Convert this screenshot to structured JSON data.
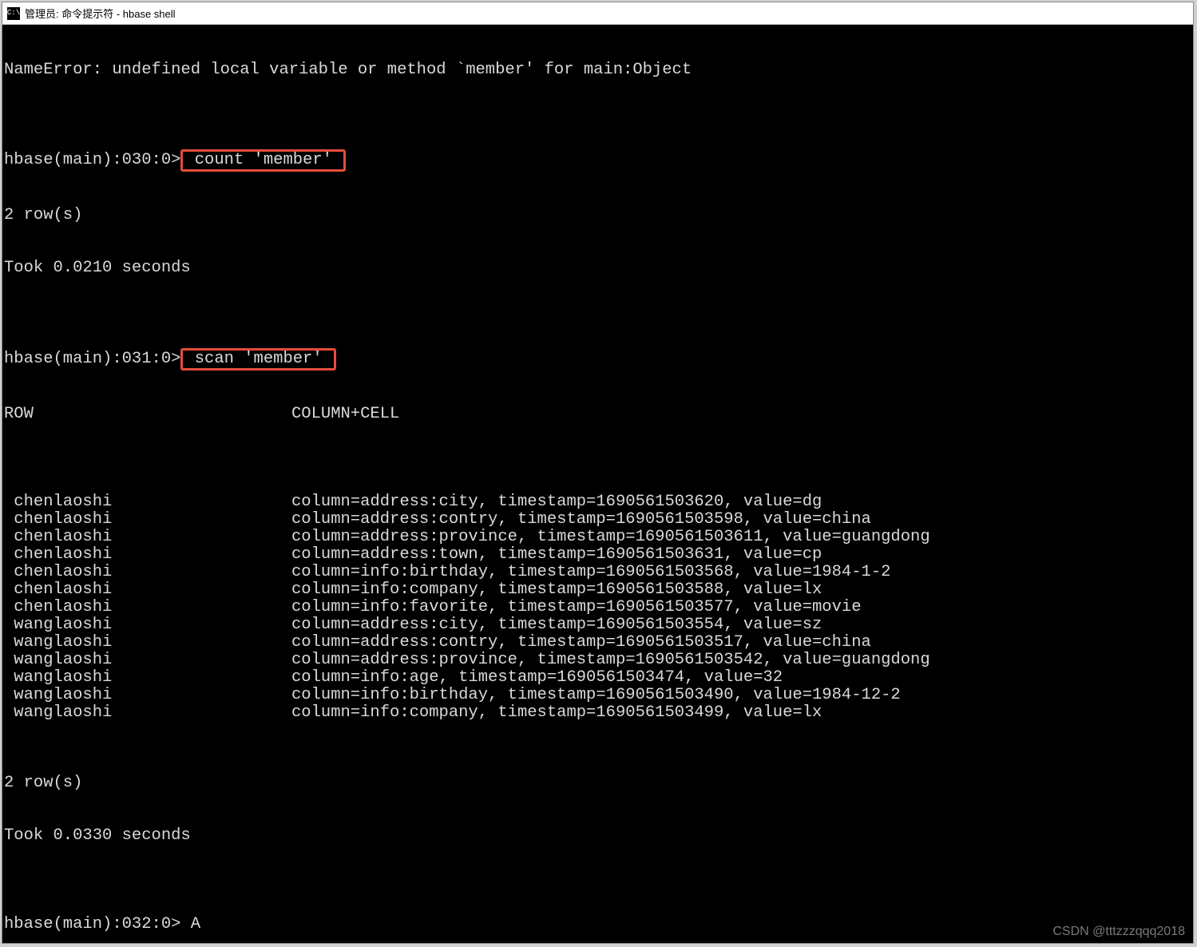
{
  "window": {
    "title": "管理员: 命令提示符 - hbase  shell",
    "icon_label": "C:\\"
  },
  "terminal": {
    "error_line": "NameError: undefined local variable or method `member' for main:Object",
    "prompt1_prefix": "hbase(main):030:0>",
    "prompt1_cmd": " count 'member' ",
    "result1_rows": "2 row(s)",
    "result1_time": "Took 0.0210 seconds",
    "prompt2_prefix": "hbase(main):031:0>",
    "prompt2_cmd": " scan 'member' ",
    "header_row": "ROW",
    "header_col": "COLUMN+CELL",
    "scan_rows": [
      {
        "row": " chenlaoshi",
        "col": "column=address:city, timestamp=1690561503620, value=dg"
      },
      {
        "row": " chenlaoshi",
        "col": "column=address:contry, timestamp=1690561503598, value=china"
      },
      {
        "row": " chenlaoshi",
        "col": "column=address:province, timestamp=1690561503611, value=guangdong"
      },
      {
        "row": " chenlaoshi",
        "col": "column=address:town, timestamp=1690561503631, value=cp"
      },
      {
        "row": " chenlaoshi",
        "col": "column=info:birthday, timestamp=1690561503568, value=1984-1-2"
      },
      {
        "row": " chenlaoshi",
        "col": "column=info:company, timestamp=1690561503588, value=lx"
      },
      {
        "row": " chenlaoshi",
        "col": "column=info:favorite, timestamp=1690561503577, value=movie"
      },
      {
        "row": " wanglaoshi",
        "col": "column=address:city, timestamp=1690561503554, value=sz"
      },
      {
        "row": " wanglaoshi",
        "col": "column=address:contry, timestamp=1690561503517, value=china"
      },
      {
        "row": " wanglaoshi",
        "col": "column=address:province, timestamp=1690561503542, value=guangdong"
      },
      {
        "row": " wanglaoshi",
        "col": "column=info:age, timestamp=1690561503474, value=32"
      },
      {
        "row": " wanglaoshi",
        "col": "column=info:birthday, timestamp=1690561503490, value=1984-12-2"
      },
      {
        "row": " wanglaoshi",
        "col": "column=info:company, timestamp=1690561503499, value=lx"
      }
    ],
    "result2_rows": "2 row(s)",
    "result2_time": "Took 0.0330 seconds",
    "prompt3_prefix": "hbase(main):032:0> ",
    "prompt3_input": "A"
  },
  "watermark": "CSDN @tttzzzqqq2018"
}
